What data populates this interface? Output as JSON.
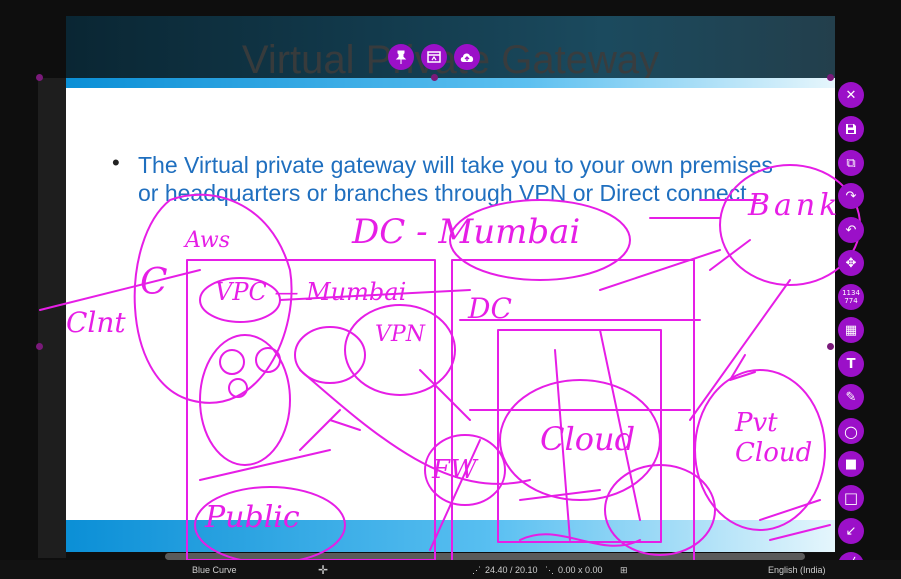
{
  "slide": {
    "title": "Virtual Private Gateway",
    "bullet": "•",
    "bullet_text": "The Virtual private gateway will take you to your own premises or headquarters or branches through VPN or Direct connect"
  },
  "top_toolbar": {
    "pin_icon": "pin-icon",
    "window_icon": "window-icon",
    "upload_icon": "cloud-upload-icon"
  },
  "right_toolbar": {
    "close": "✕",
    "save": "💾",
    "copy": "⧉",
    "redo": "↷",
    "undo": "↶",
    "move": "✥",
    "coords_line1": "1134",
    "coords_line2": "774",
    "pixelate": "▦",
    "text": "T",
    "pen": "✎",
    "circle": "○",
    "filled_rect": "■",
    "rect": "□",
    "arrow": "↙",
    "line": "╱"
  },
  "statusbar": {
    "theme": "Blue Curve",
    "position": "24.40 / 20.10",
    "size": "0.00 x 0.00",
    "language": "English (India)"
  },
  "annotations": {
    "color": "#e61ee6",
    "words": [
      "Aws",
      "VPC — Mumbai",
      "DC - Mumbai",
      "DC",
      "Clnt",
      "C",
      "Public",
      "FW",
      "Cloud",
      "Pvt Cloud",
      "Bank",
      "VPN"
    ]
  },
  "colors": {
    "accent": "#9b10c8",
    "slide_text": "#1f6fbf",
    "slide_bar": "#0b8fd6"
  }
}
